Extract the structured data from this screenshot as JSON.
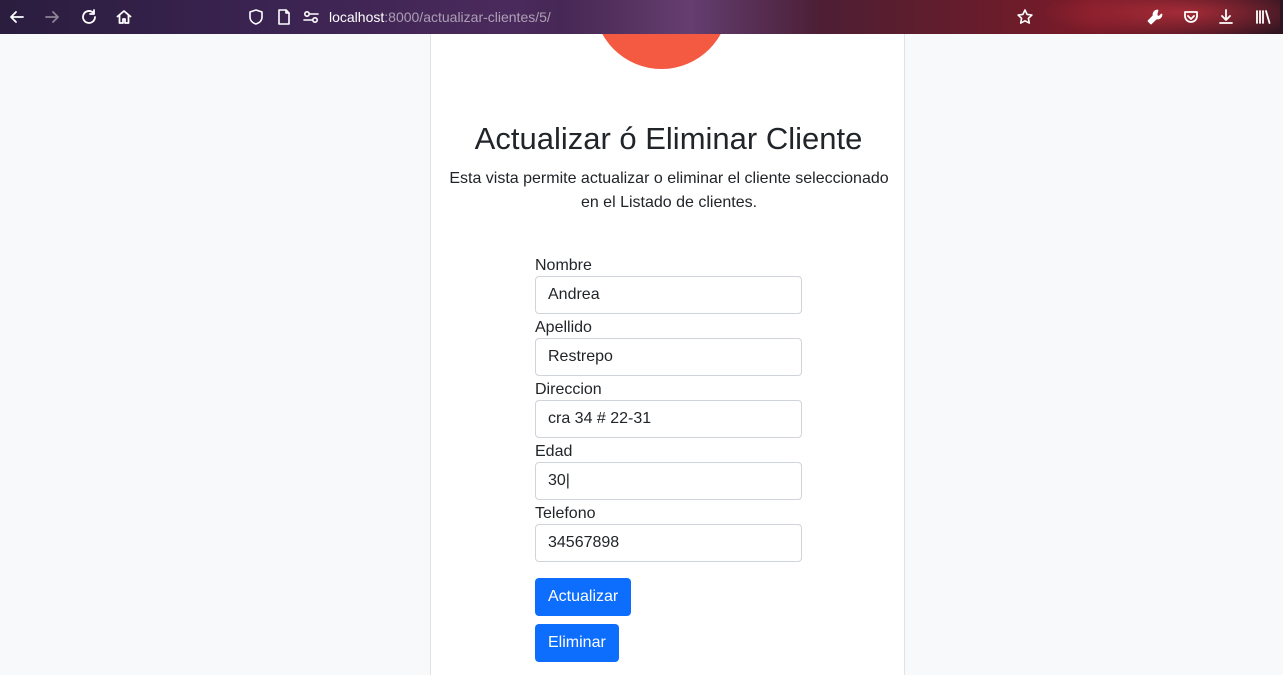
{
  "browser": {
    "url_host": "localhost",
    "url_path": ":8000/actualizar-clientes/5/",
    "icons": [
      "back-icon",
      "forward-icon",
      "reload-icon",
      "home-icon",
      "shield-icon",
      "page-icon",
      "permissions-icon",
      "bookmark-star-icon",
      "wrench-icon",
      "pocket-icon",
      "download-icon",
      "library-icon"
    ]
  },
  "page": {
    "title": "Actualizar ó Eliminar Cliente",
    "description": "Esta vista permite actualizar o eliminar el cliente seleccionado en el Listado de clientes.",
    "logo_color": "#f35a41"
  },
  "form": {
    "fields": [
      {
        "label": "Nombre",
        "value": "Andrea"
      },
      {
        "label": "Apellido",
        "value": "Restrepo"
      },
      {
        "label": "Direccion",
        "value": "cra 34 # 22-31"
      },
      {
        "label": "Edad",
        "value": "30|"
      },
      {
        "label": "Telefono",
        "value": "34567898"
      }
    ],
    "update_label": "Actualizar",
    "delete_label": "Eliminar",
    "button_color": "#0d6efd"
  }
}
